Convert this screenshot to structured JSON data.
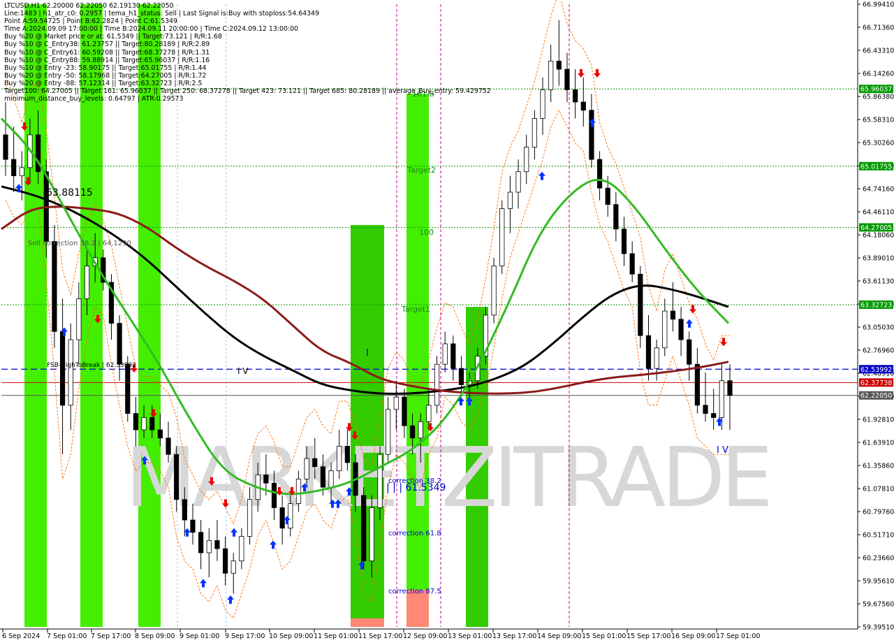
{
  "symbol_line": "LTCUSD,H1  62.20000 62.22050 62.19130 62.22050",
  "info_lines": [
    "Line:1483 | h1_atr_c0: 0.2957 | tema_h1_status: Sell | Last Signal is:Buy with stoploss:54.64349",
    "Point A:59.54725 | Point B:62.2824 | Point C:61.5349",
    "Time A:2024.09.09 17:00:00 | Time B:2024.09.11 20:00:00 | Time C:2024.09.12 13:00:00",
    "Buy %20 @ Market price or at: 61.5349 || Target:73.121 | R/R:1.68",
    "Buy %10 @ C_Entry38: 61.23757 || Target:80.28189 | R/R:2.89",
    "Buy %10 @ C_Entry61: 60.59208 || Target:68.37278 | R/R:1.31",
    "Buy %10 @ C_Entry88: 59.88914 || Target:65.96037 | R/R:1.16",
    "Buy %10 @ Entry -23: 58.90175 || Target:65.01755 | R/R:1.44",
    "Buy %20 @ Entry -50: 58.17968 || Target:64.27005 | R/R:1.72",
    "Buy %20 @ Entry -88: 57.12314 || Target:63.32723 | R/R:2.5",
    "Target100: 64.27005 || Target 161: 65.96037 || Target 250: 68.37278 || Target 423: 73.121 || Target 685: 80.28189 || average_Buy_entry: 59.429752",
    "minimum_distance_buy_levels: 0.64797 | ATR:0.29573"
  ],
  "watermark": "MARKETZITRADE",
  "chart_data": {
    "type": "candlestick",
    "symbol": "LTCUSD",
    "timeframe": "H1",
    "ylim": [
      59.3951,
      66.9941
    ],
    "y_ticks": [
      "66.99410",
      "66.71360",
      "66.43310",
      "66.14260",
      "65.86380",
      "65.58310",
      "65.30260",
      "65.02210",
      "64.74160",
      "64.46110",
      "64.18060",
      "63.89010",
      "63.61130",
      "63.33080",
      "63.05030",
      "62.76960",
      "62.48910",
      "62.20860",
      "61.92810",
      "61.63910",
      "61.35860",
      "61.07810",
      "60.79760",
      "60.51710",
      "60.23660",
      "59.95610",
      "59.67560",
      "59.39510"
    ],
    "x_labels": [
      "6 Sep 2024",
      "7 Sep 01:00",
      "7 Sep 17:00",
      "8 Sep 09:00",
      "9 Sep 01:00",
      "9 Sep 17:00",
      "10 Sep 09:00",
      "11 Sep 01:00",
      "11 Sep 17:00",
      "12 Sep 09:00",
      "13 Sep 01:00",
      "13 Sep 17:00",
      "14 Sep 09:00",
      "15 Sep 01:00",
      "15 Sep 17:00",
      "16 Sep 09:00",
      "17 Sep 01:00"
    ],
    "price_levels": [
      {
        "price": 65.96037,
        "label": "65.96037",
        "color": "#009900",
        "style": "dotted"
      },
      {
        "price": 65.01755,
        "label": "65.01755",
        "color": "#009900",
        "style": "dotted"
      },
      {
        "price": 64.27005,
        "label": "64.27005",
        "color": "#009900",
        "style": "dotted"
      },
      {
        "price": 63.32723,
        "label": "63.32723",
        "color": "#009900",
        "style": "dotted"
      },
      {
        "price": 62.53992,
        "label": "62.53992",
        "color": "#0000cc",
        "style": "dashed"
      },
      {
        "price": 62.37738,
        "label": "62.37738",
        "color": "#cc0000",
        "style": "solid"
      },
      {
        "price": 62.2205,
        "label": "62.22050",
        "color": "#555555",
        "style": "solid"
      }
    ],
    "annotations": [
      {
        "text": "63.88115",
        "price": 64.7
      },
      {
        "text": "Sell correction 38.2 | 64.1290",
        "price": 64.06
      },
      {
        "text": "FSB-HighToBreak | 62.53992",
        "price": 62.6
      },
      {
        "text": "I V",
        "price": 62.5
      },
      {
        "text": "I",
        "price": 62.85
      },
      {
        "text": "161.8",
        "price": 65.88
      },
      {
        "text": "Target2",
        "price": 65.08
      },
      {
        "text": "100",
        "price": 64.3
      },
      {
        "text": "Target1",
        "price": 63.28
      },
      {
        "text": "correction 38.2",
        "price": 61.13
      },
      {
        "text": "| | | 61.5349",
        "price": 61.03
      },
      {
        "text": "correction 61.8",
        "price": 60.52
      },
      {
        "text": "correction 87.5",
        "price": 59.82
      },
      {
        "text": "I V",
        "price": 61.63
      }
    ],
    "series": [
      {
        "name": "",
        "color": "#000000",
        "values": [
          64.77,
          64.68,
          64.55,
          64.37,
          64.15,
          63.88,
          63.55,
          63.22,
          62.92,
          62.7,
          62.53,
          62.35,
          62.28,
          62.24,
          62.24,
          62.27,
          62.32,
          62.42,
          62.58,
          62.86,
          63.18,
          63.46,
          63.58,
          63.52,
          63.42,
          63.3
        ]
      },
      {
        "name": "",
        "color": "#8b1a1a",
        "values": [
          64.25,
          64.5,
          64.53,
          64.5,
          64.45,
          64.28,
          64.02,
          63.8,
          63.62,
          63.4,
          63.08,
          62.76,
          62.62,
          62.42,
          62.34,
          62.28,
          62.25,
          62.24,
          62.25,
          62.3,
          62.38,
          62.44,
          62.47,
          62.51,
          62.56,
          62.63
        ]
      },
      {
        "name": "",
        "color": "#33bb22",
        "values": [
          65.6,
          65.2,
          64.5,
          63.8,
          63.2,
          62.6,
          61.9,
          61.3,
          61.1,
          61.0,
          61.05,
          61.15,
          61.35,
          61.55,
          61.9,
          62.5,
          63.3,
          64.2,
          64.7,
          64.92,
          64.55,
          64.0,
          63.5,
          63.1
        ]
      }
    ],
    "bands": [
      {
        "color": "#44ee00",
        "from": 66.9941,
        "to": 59.3951
      },
      {
        "color": "#33cc00",
        "from": 64.3,
        "to": 59.3951
      },
      {
        "color": "#ff8877",
        "from": 59.9,
        "to": 59.3951
      }
    ],
    "candles": [
      [
        65.4,
        65.8,
        64.9,
        65.1
      ],
      [
        65.1,
        65.5,
        64.7,
        64.9
      ],
      [
        64.9,
        65.2,
        64.6,
        65.0
      ],
      [
        65.0,
        65.6,
        64.8,
        65.4
      ],
      [
        65.4,
        65.7,
        64.8,
        64.95
      ],
      [
        64.95,
        65.1,
        63.9,
        64.1
      ],
      [
        64.1,
        64.3,
        62.8,
        63.0
      ],
      [
        63.0,
        63.4,
        61.5,
        62.1
      ],
      [
        62.1,
        63.1,
        61.8,
        62.9
      ],
      [
        62.9,
        63.6,
        62.6,
        63.4
      ],
      [
        63.4,
        64.0,
        63.2,
        63.8
      ],
      [
        63.8,
        64.2,
        63.6,
        63.9
      ],
      [
        63.9,
        64.0,
        63.5,
        63.6
      ],
      [
        63.6,
        63.7,
        62.9,
        63.1
      ],
      [
        63.1,
        63.2,
        62.4,
        62.6
      ],
      [
        62.6,
        62.7,
        61.9,
        62.0
      ],
      [
        62.0,
        62.2,
        61.6,
        61.8
      ],
      [
        61.8,
        62.1,
        61.7,
        61.95
      ],
      [
        61.95,
        62.1,
        61.7,
        61.8
      ],
      [
        61.8,
        62.0,
        61.6,
        61.7
      ],
      [
        61.7,
        61.9,
        61.4,
        61.5
      ],
      [
        61.5,
        61.6,
        60.8,
        60.95
      ],
      [
        60.95,
        61.1,
        60.5,
        60.7
      ],
      [
        60.7,
        60.9,
        60.4,
        60.55
      ],
      [
        60.55,
        60.7,
        60.1,
        60.3
      ],
      [
        60.3,
        60.6,
        60.0,
        60.45
      ],
      [
        60.45,
        60.7,
        60.2,
        60.35
      ],
      [
        60.35,
        60.5,
        59.9,
        60.05
      ],
      [
        60.05,
        60.3,
        59.8,
        60.2
      ],
      [
        60.2,
        60.6,
        60.1,
        60.5
      ],
      [
        60.5,
        61.1,
        60.4,
        60.95
      ],
      [
        60.95,
        61.4,
        60.8,
        61.25
      ],
      [
        61.25,
        61.5,
        61.0,
        61.15
      ],
      [
        61.15,
        61.3,
        60.7,
        60.85
      ],
      [
        60.85,
        61.0,
        60.4,
        60.6
      ],
      [
        60.6,
        61.0,
        60.5,
        60.9
      ],
      [
        60.9,
        61.3,
        60.8,
        61.2
      ],
      [
        61.2,
        61.6,
        61.1,
        61.45
      ],
      [
        61.45,
        61.7,
        61.2,
        61.35
      ],
      [
        61.35,
        61.5,
        61.0,
        61.1
      ],
      [
        61.1,
        61.4,
        60.9,
        61.3
      ],
      [
        61.3,
        61.8,
        61.2,
        61.6
      ],
      [
        61.6,
        61.8,
        61.3,
        61.4
      ],
      [
        61.4,
        61.5,
        60.8,
        61.0
      ],
      [
        61.0,
        61.1,
        60.1,
        60.2
      ],
      [
        60.2,
        61.0,
        60.0,
        60.85
      ],
      [
        60.85,
        61.6,
        60.7,
        61.5
      ],
      [
        61.5,
        62.2,
        61.4,
        62.05
      ],
      [
        62.05,
        62.4,
        61.8,
        62.2
      ],
      [
        62.2,
        62.3,
        61.7,
        61.85
      ],
      [
        61.85,
        62.0,
        61.5,
        61.7
      ],
      [
        61.7,
        62.0,
        61.4,
        61.9
      ],
      [
        61.9,
        62.3,
        61.8,
        62.1
      ],
      [
        62.1,
        62.7,
        62.0,
        62.6
      ],
      [
        62.6,
        63.0,
        62.5,
        62.85
      ],
      [
        62.85,
        62.95,
        62.4,
        62.55
      ],
      [
        62.55,
        62.7,
        62.2,
        62.35
      ],
      [
        62.35,
        62.5,
        62.1,
        62.4
      ],
      [
        62.4,
        62.8,
        62.3,
        62.7
      ],
      [
        62.7,
        63.3,
        62.6,
        63.2
      ],
      [
        63.2,
        63.9,
        63.1,
        63.8
      ],
      [
        63.8,
        64.6,
        63.7,
        64.5
      ],
      [
        64.5,
        64.9,
        64.2,
        64.7
      ],
      [
        64.7,
        65.1,
        64.5,
        64.95
      ],
      [
        64.95,
        65.4,
        64.8,
        65.25
      ],
      [
        65.25,
        65.7,
        65.1,
        65.6
      ],
      [
        65.6,
        66.1,
        65.4,
        65.95
      ],
      [
        65.95,
        66.5,
        65.8,
        66.3
      ],
      [
        66.3,
        66.8,
        66.0,
        66.2
      ],
      [
        66.2,
        66.4,
        65.8,
        65.95
      ],
      [
        65.95,
        66.2,
        65.6,
        65.8
      ],
      [
        65.8,
        66.1,
        65.5,
        65.7
      ],
      [
        65.7,
        65.9,
        65.0,
        65.1
      ],
      [
        65.1,
        65.2,
        64.6,
        64.75
      ],
      [
        64.75,
        64.9,
        64.4,
        64.55
      ],
      [
        64.55,
        64.7,
        64.1,
        64.25
      ],
      [
        64.25,
        64.4,
        63.8,
        63.95
      ],
      [
        63.95,
        64.1,
        63.6,
        63.7
      ],
      [
        63.7,
        63.8,
        62.8,
        62.95
      ],
      [
        62.95,
        63.2,
        62.4,
        62.55
      ],
      [
        62.55,
        62.9,
        62.4,
        62.8
      ],
      [
        62.8,
        63.4,
        62.7,
        63.25
      ],
      [
        63.25,
        63.6,
        63.0,
        63.15
      ],
      [
        63.15,
        63.3,
        62.7,
        62.9
      ],
      [
        62.9,
        63.0,
        62.4,
        62.6
      ],
      [
        62.6,
        62.8,
        62.0,
        62.1
      ],
      [
        62.1,
        62.5,
        61.9,
        62.0
      ],
      [
        62.0,
        62.3,
        61.8,
        61.95
      ],
      [
        61.95,
        62.6,
        61.8,
        62.4
      ],
      [
        62.4,
        62.6,
        61.8,
        62.22
      ]
    ]
  }
}
